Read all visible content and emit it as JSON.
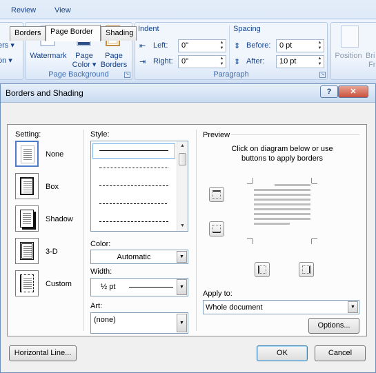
{
  "ribbon": {
    "tabs": [
      "Review",
      "View"
    ],
    "left_cut_labels": [
      "ers ▾",
      "on ▾"
    ],
    "page_background": {
      "label": "Page Background",
      "watermark": "Watermark",
      "page_color_1": "Page",
      "page_color_2": "Color ▾",
      "page_borders_1": "Page",
      "page_borders_2": "Borders"
    },
    "paragraph": {
      "label": "Paragraph",
      "indent_title": "Indent",
      "left_label": "Left:",
      "left_value": "0\"",
      "right_label": "Right:",
      "right_value": "0\"",
      "spacing_title": "Spacing",
      "before_label": "Before:",
      "before_value": "0 pt",
      "after_label": "After:",
      "after_value": "10 pt"
    },
    "arrange": {
      "position": "Position",
      "cut_1": "Bri",
      "cut_2": "Fr"
    }
  },
  "dialog": {
    "title": "Borders and Shading",
    "help": "?",
    "close": "✕",
    "tabs": [
      "Borders",
      "Page Border",
      "Shading"
    ],
    "active_tab": "Page Border",
    "setting": {
      "label": "Setting:",
      "options": [
        "None",
        "Box",
        "Shadow",
        "3-D",
        "Custom"
      ],
      "selected": "None"
    },
    "style": {
      "label": "Style:"
    },
    "color": {
      "label": "Color:",
      "value": "Automatic"
    },
    "width": {
      "label": "Width:",
      "value": "½ pt"
    },
    "art": {
      "label": "Art:",
      "value": "(none)"
    },
    "preview": {
      "label": "Preview",
      "help_line1": "Click on diagram below or use",
      "help_line2": "buttons to apply borders"
    },
    "apply_to": {
      "label": "Apply to:",
      "value": "Whole document"
    },
    "options_button": "Options...",
    "horizontal_line_button": "Horizontal Line...",
    "ok_button": "OK",
    "cancel_button": "Cancel"
  }
}
